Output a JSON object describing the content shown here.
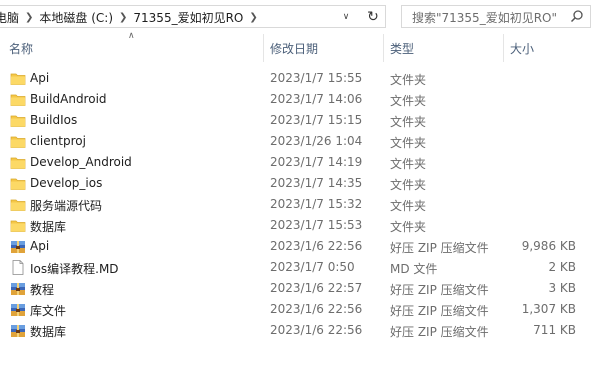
{
  "address": {
    "crumbs": [
      "电脑",
      "本地磁盘 (C:)",
      "71355_爱如初见RO"
    ]
  },
  "search": {
    "placeholder": "搜索\"71355_爱如初见RO\""
  },
  "columns": {
    "name": "名称",
    "date": "修改日期",
    "type": "类型",
    "size": "大小"
  },
  "files": [
    {
      "name": "Api",
      "date": "2023/1/7 15:55",
      "type": "文件夹",
      "size": "",
      "icon": "folder-icon"
    },
    {
      "name": "BuildAndroid",
      "date": "2023/1/7 14:06",
      "type": "文件夹",
      "size": "",
      "icon": "folder-icon"
    },
    {
      "name": "BuildIos",
      "date": "2023/1/7 15:15",
      "type": "文件夹",
      "size": "",
      "icon": "folder-icon"
    },
    {
      "name": "clientproj",
      "date": "2023/1/26 1:04",
      "type": "文件夹",
      "size": "",
      "icon": "folder-icon"
    },
    {
      "name": "Develop_Android",
      "date": "2023/1/7 14:19",
      "type": "文件夹",
      "size": "",
      "icon": "folder-icon"
    },
    {
      "name": "Develop_ios",
      "date": "2023/1/7 14:35",
      "type": "文件夹",
      "size": "",
      "icon": "folder-icon"
    },
    {
      "name": "服务端源代码",
      "date": "2023/1/7 15:32",
      "type": "文件夹",
      "size": "",
      "icon": "folder-icon"
    },
    {
      "name": "数据库",
      "date": "2023/1/7 15:53",
      "type": "文件夹",
      "size": "",
      "icon": "folder-icon"
    },
    {
      "name": "Api",
      "date": "2023/1/6 22:56",
      "type": "好压 ZIP 压缩文件",
      "size": "9,986 KB",
      "icon": "zip-archive-icon"
    },
    {
      "name": "Ios编译教程.MD",
      "date": "2023/1/7 0:50",
      "type": "MD 文件",
      "size": "2 KB",
      "icon": "document-icon"
    },
    {
      "name": "教程",
      "date": "2023/1/6 22:57",
      "type": "好压 ZIP 压缩文件",
      "size": "3 KB",
      "icon": "zip-archive-icon"
    },
    {
      "name": "库文件",
      "date": "2023/1/6 22:56",
      "type": "好压 ZIP 压缩文件",
      "size": "1,307 KB",
      "icon": "zip-archive-icon"
    },
    {
      "name": "数据库",
      "date": "2023/1/6 22:56",
      "type": "好压 ZIP 压缩文件",
      "size": "711 KB",
      "icon": "zip-archive-icon"
    }
  ],
  "colors": {
    "folder": "#f5c748",
    "header_text": "#4c607a",
    "muted_text": "#6d6d6d"
  }
}
